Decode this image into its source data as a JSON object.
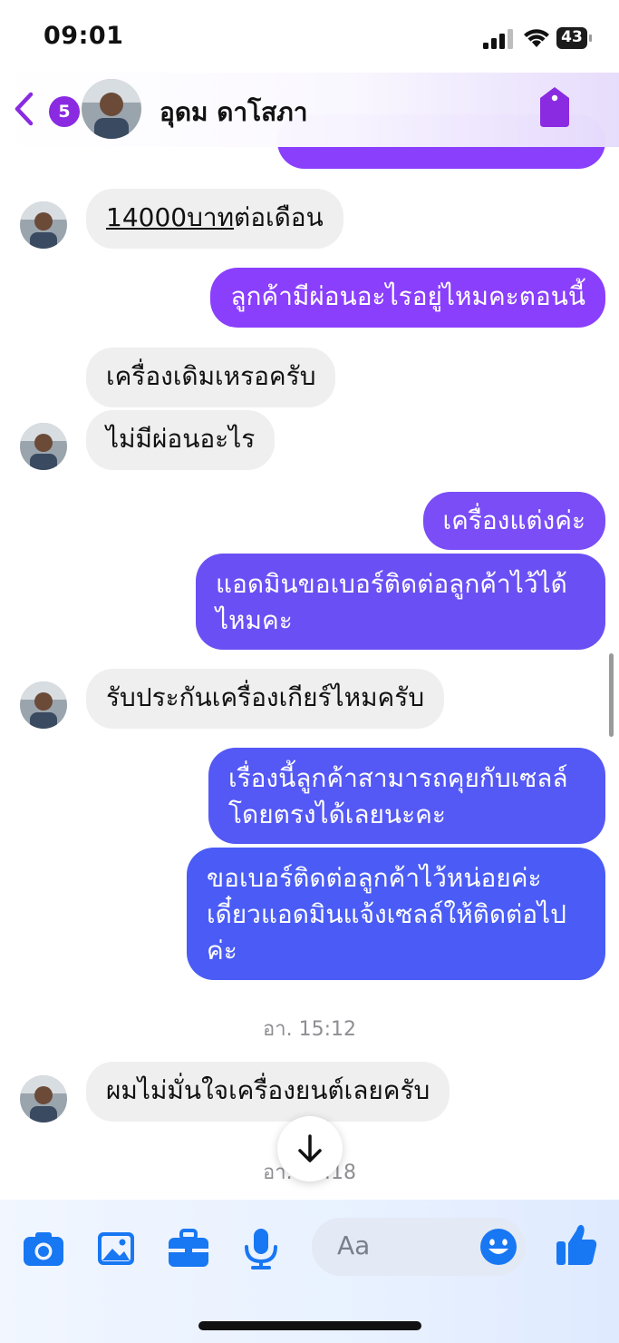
{
  "status": {
    "time": "09:01",
    "battery": "43"
  },
  "header": {
    "unread_count": "5",
    "contact_name": "อุดม ดาโสภา"
  },
  "messages": {
    "m0": "14000บาทต่อเดือน",
    "m0_underlined": "14000บาท",
    "m0_rest": "ต่อเดือน",
    "m1": "ลูกค้ามีผ่อนอะไรอยู่ไหมคะตอนนี้",
    "m2": "เครื่องเดิมเหรอครับ",
    "m3": "ไม่มีผ่อนอะไร",
    "m4": "เครื่องแต่งค่ะ",
    "m5_l1": "แอดมินขอเบอร์ติดต่อลูกค้าไว้ได้",
    "m5_l2": "ไหมคะ",
    "m6": "รับประกันเครื่องเกียร์ไหมครับ",
    "m7_l1": "เรื่องนี้ลูกค้าสามารถคุยกับเซลล์",
    "m7_l2": "โดยตรงได้เลยนะคะ",
    "m8_l1": "ขอเบอร์ติดต่อลูกค้าไว้หน่อยค่ะ",
    "m8_l2": "เดี๋ยวแอดมินแจ้งเซลล์ให้ติดต่อไป",
    "m8_l3": "ค่ะ",
    "time1": "อา. 15:12",
    "m9": "ผมไม่มั่นใจเครื่องยนต์เลยครับ",
    "time2": "อา. 15:18"
  },
  "composer": {
    "placeholder": "Aa"
  },
  "colors": {
    "purple": "#8a3ffc",
    "violet": "#7a4df7",
    "blue": "#4a5cf5",
    "incoming": "#efefef",
    "accent": "#1877f2"
  },
  "icons": [
    "back-chevron-icon",
    "tag-icon",
    "camera-icon",
    "image-icon",
    "briefcase-icon",
    "microphone-icon",
    "emoji-icon",
    "thumbs-up-icon",
    "arrow-down-icon"
  ]
}
